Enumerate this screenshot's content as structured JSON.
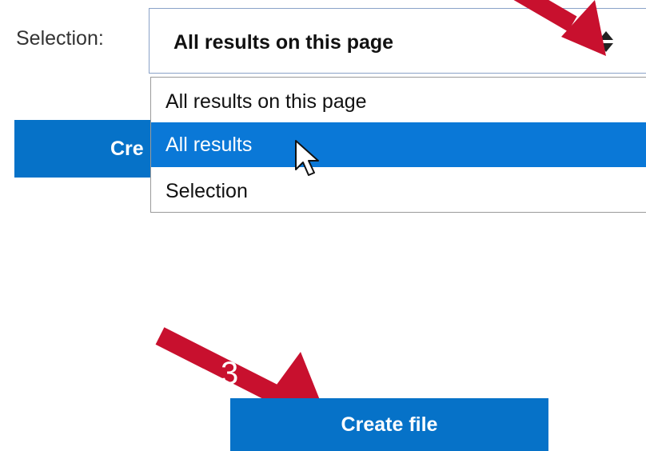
{
  "form": {
    "selection_label": "Selection:",
    "select": {
      "value": "All results on this page",
      "options": [
        "All results on this page",
        "All results",
        "Selection"
      ],
      "highlighted_index": 1
    },
    "partial_button_text": "Cre",
    "create_button_label": "Create file"
  },
  "annotations": {
    "arrow_color": "#c8102e",
    "step_3_label": "3"
  },
  "colors": {
    "button_blue": "#0672c8",
    "option_highlight": "#0a78d7"
  },
  "icons": {
    "select_caret": "sort-up-down-icon",
    "pointer": "mouse-pointer-icon"
  }
}
